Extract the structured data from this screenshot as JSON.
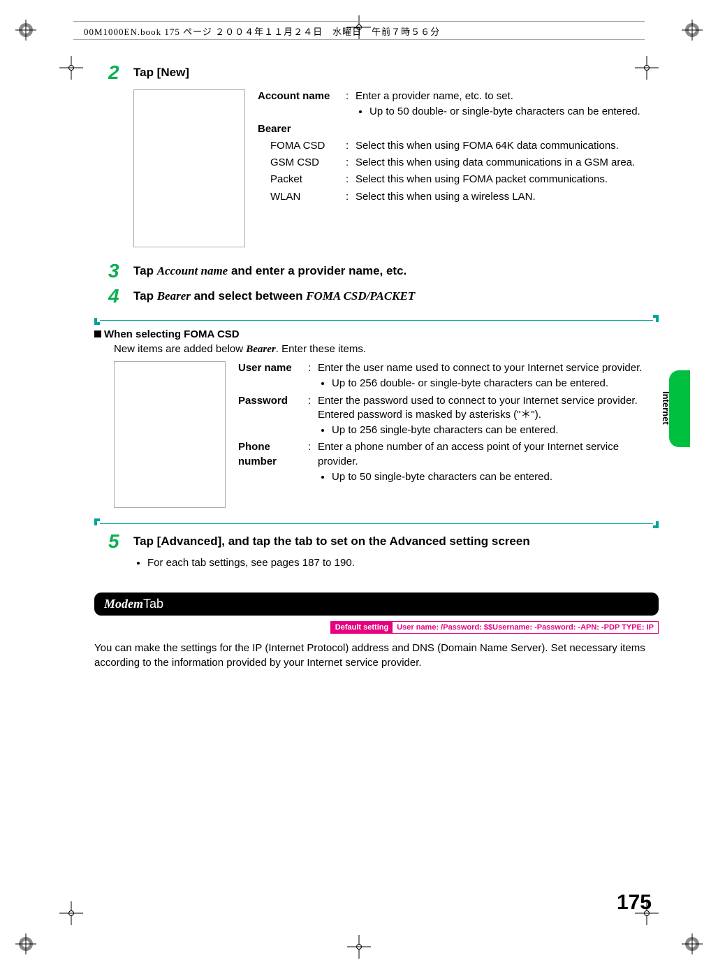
{
  "book_info": "00M1000EN.book  175 ページ  ２００４年１１月２４日　水曜日　午前７時５６分",
  "steps": {
    "s2": {
      "num": "2",
      "title_pre": "Tap [New]"
    },
    "s3": {
      "num": "3",
      "title_pre": "Tap ",
      "title_ital": "Account name",
      "title_post": " and enter a provider name, etc."
    },
    "s4": {
      "num": "4",
      "title_pre": "Tap ",
      "title_ital": "Bearer",
      "title_mid": " and select between ",
      "title_ital2": "FOMA CSD/PACKET"
    },
    "s5": {
      "num": "5",
      "title_pre": "Tap [Advanced], and tap the tab to set on the Advanced setting screen"
    },
    "s5_note": "For each tab settings, see pages 187 to 190."
  },
  "defs1": {
    "account_name": {
      "label": "Account name",
      "val": "Enter a provider name, etc. to set.",
      "bullet": "Up to 50 double- or single-byte characters can be entered."
    },
    "bearer_label": "Bearer",
    "bearer_items": [
      {
        "label": "FOMA CSD",
        "val": "Select this when using FOMA 64K data communications."
      },
      {
        "label": "GSM CSD",
        "val": "Select this when using data communications in a GSM area."
      },
      {
        "label": "Packet",
        "val": "Select this when using FOMA packet communications."
      },
      {
        "label": "WLAN",
        "val": "Select this when using a wireless LAN."
      }
    ]
  },
  "csd_section": {
    "title": "When selecting FOMA CSD",
    "desc_pre": "New items are added below ",
    "desc_ital": "Bearer",
    "desc_post": ". Enter these items."
  },
  "defs2": [
    {
      "label": "User name",
      "val": "Enter the user name used to connect to your Internet service provider.",
      "bullet": "Up to 256 double- or single-byte characters can be entered."
    },
    {
      "label": "Password",
      "val": "Enter the password used to connect to your Internet service provider. Entered password is masked by asterisks (\"＊\").",
      "bullet": "Up to 256 single-byte characters can be entered."
    },
    {
      "label": "Phone number",
      "val": "Enter a phone number of an access point of your Internet service provider.",
      "bullet": "Up to 50 single-byte characters can be entered."
    }
  ],
  "modem": {
    "heading_ital": "Modem",
    "heading_post": " Tab",
    "default_label": "Default setting",
    "default_value": "User name: /Password: $$Username: -Password: -APN: -PDP TYPE: IP",
    "para": "You can make the settings for the IP (Internet Protocol) address and DNS (Domain Name Server). Set necessary items according to the information provided by your Internet service provider."
  },
  "side_label": "Internet",
  "page_number": "175"
}
